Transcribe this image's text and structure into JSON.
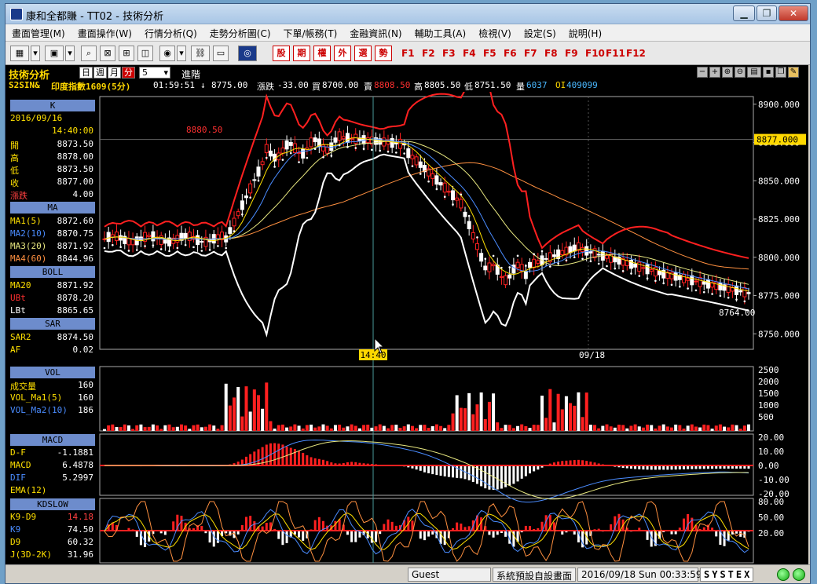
{
  "window": {
    "title": "康和全都賺 - TT02 - 技術分析"
  },
  "menu": [
    "畫面管理(M)",
    "畫面操作(W)",
    "行情分析(Q)",
    "走勢分析圖(C)",
    "下單/帳務(T)",
    "金融資訊(N)",
    "輔助工具(A)",
    "檢視(V)",
    "設定(S)",
    "說明(H)"
  ],
  "toolbar": {
    "quick_buttons": [
      "股",
      "期",
      "權",
      "外",
      "選",
      "勢"
    ],
    "fkeys": [
      "F1",
      "F2",
      "F3",
      "F4",
      "F5",
      "F6",
      "F7",
      "F8",
      "F9",
      "F10",
      "F11",
      "F12"
    ]
  },
  "header": {
    "title": "技術分析",
    "periods": [
      "日",
      "週",
      "月",
      "分"
    ],
    "selected_period": "分",
    "interval": "5",
    "advanced": "進階"
  },
  "quote": {
    "symbol": "S2SIN&",
    "name": "印度指數1609(5分)",
    "time": "01:59:51",
    "arrow": "↓",
    "last": "8775.00",
    "change_label": "漲跌",
    "change": "-33.00",
    "bid_label": "買",
    "bid": "8700.00",
    "ask_label": "賣",
    "ask": "8808.50",
    "high_label": "高",
    "high": "8805.50",
    "low_label": "低",
    "low": "8751.50",
    "vol_label": "量",
    "vol": "6037",
    "oi_label": "OI",
    "oi": "409099"
  },
  "sidebar": {
    "k": {
      "label": "K",
      "date": "2016/09/16",
      "time": "14:40:00",
      "rows": [
        {
          "k": "開",
          "v": "8873.50"
        },
        {
          "k": "高",
          "v": "8878.00"
        },
        {
          "k": "低",
          "v": "8873.50"
        },
        {
          "k": "收",
          "v": "8877.00"
        },
        {
          "k": "漲跌",
          "v": "4.00"
        }
      ]
    },
    "ma": {
      "label": "MA",
      "rows": [
        {
          "k": "MA1(5)",
          "v": "8872.60",
          "color": "#ffe000"
        },
        {
          "k": "MA2(10)",
          "v": "8870.75",
          "color": "#4a8cff"
        },
        {
          "k": "MA3(20)",
          "v": "8871.92",
          "color": "#e8e880"
        },
        {
          "k": "MA4(60)",
          "v": "8844.96",
          "color": "#ff9040"
        }
      ]
    },
    "boll": {
      "label": "BOLL",
      "rows": [
        {
          "k": "MA20",
          "v": "8871.92",
          "color": "#ffe000"
        },
        {
          "k": "UBt",
          "v": "8878.20",
          "color": "#ff3030"
        },
        {
          "k": "LBt",
          "v": "8865.65",
          "color": "#ffffff"
        }
      ]
    },
    "sar": {
      "label": "SAR",
      "rows": [
        {
          "k": "SAR2",
          "v": "8874.50",
          "color": "#ffe000"
        },
        {
          "k": "AF",
          "v": "0.02",
          "color": "#ffe000"
        }
      ]
    },
    "vol": {
      "label": "VOL",
      "rows": [
        {
          "k": "成交量",
          "v": "160",
          "color": "#ffe000"
        },
        {
          "k": "VOL_Ma1(5)",
          "v": "160",
          "color": "#ffe000"
        },
        {
          "k": "VOL_Ma2(10)",
          "v": "186",
          "color": "#4a8cff"
        }
      ]
    },
    "macd": {
      "label": "MACD",
      "rows": [
        {
          "k": "D-F",
          "v": "-1.1881",
          "color": "#ffe000"
        },
        {
          "k": "MACD",
          "v": "6.4878",
          "color": "#ffe000"
        },
        {
          "k": "DIF",
          "v": "5.2997",
          "color": "#4a8cff"
        },
        {
          "k": "EMA(12)",
          "v": "",
          "color": "#ffe000"
        }
      ]
    },
    "kd": {
      "label": "KDSLOW",
      "rows": [
        {
          "k": "K9-D9",
          "v": "14.18",
          "color": "#ffe000",
          "vcolor": "#ff4040"
        },
        {
          "k": "K9",
          "v": "74.50",
          "color": "#4a8cff"
        },
        {
          "k": "D9",
          "v": "60.32",
          "color": "#ffe000"
        },
        {
          "k": "J(3D-2K)",
          "v": "31.96",
          "color": "#ffe000"
        }
      ]
    }
  },
  "chart": {
    "price_ticks": [
      "8900.000",
      "8875.000",
      "8850.000",
      "8825.000",
      "8800.000",
      "8775.000",
      "8750.000"
    ],
    "price_ticks_values": [
      8900,
      8875,
      8850,
      8825,
      8800,
      8775,
      8750
    ],
    "current_price_label": "8877.000",
    "current_price": 8877,
    "high_annotation": "8880.50",
    "low_annotation": "8764.00",
    "cursor_time": "14:40",
    "date_marker": "09/18",
    "vol_ticks": [
      "2500",
      "2000",
      "1500",
      "1000",
      "500"
    ],
    "macd_ticks": [
      "20.00",
      "10.00",
      "0.00",
      "-10.00",
      "-20.00"
    ],
    "kd_ticks": [
      "80.00",
      "50.00",
      "20.00"
    ]
  },
  "status": {
    "user": "Guest",
    "screen": "系統預設自設畫面",
    "datetime": "2016/09/18 Sun 00:33:59",
    "brand": "SYSTEX"
  }
}
